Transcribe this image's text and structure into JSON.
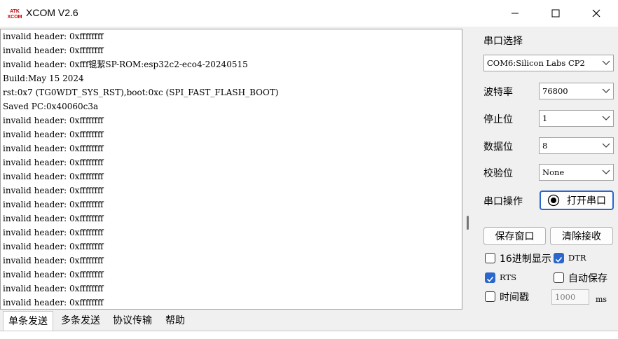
{
  "window": {
    "title": "XCOM V2.6"
  },
  "log_lines": [
    "invalid header: 0xffffffff",
    "invalid header: 0xffffffff",
    "invalid header: 0xfff锟絜SP-ROM:esp32c2-eco4-20240515",
    "Build:May 15 2024",
    "rst:0x7 (TG0WDT_SYS_RST),boot:0xc (SPI_FAST_FLASH_BOOT)",
    "Saved PC:0x40060c3a",
    "invalid header: 0xffffffff",
    "invalid header: 0xffffffff",
    "invalid header: 0xffffffff",
    "invalid header: 0xffffffff",
    "invalid header: 0xffffffff",
    "invalid header: 0xffffffff",
    "invalid header: 0xffffffff",
    "invalid header: 0xffffffff",
    "invalid header: 0xffffffff",
    "invalid header: 0xffffffff",
    "invalid header: 0xffffffff",
    "invalid header: 0xffffffff",
    "invalid header: 0xffffffff",
    "invalid header: 0xffffffff"
  ],
  "settings": {
    "port_select_label": "串口选择",
    "port_value": "COM6:Silicon Labs CP2",
    "baud_label": "波特率",
    "baud_value": "76800",
    "stopbits_label": "停止位",
    "stopbits_value": "1",
    "databits_label": "数据位",
    "databits_value": "8",
    "parity_label": "校验位",
    "parity_value": "None",
    "port_op_label": "串口操作",
    "open_port_label": "打开串口",
    "save_window_label": "保存窗口",
    "clear_recv_label": "清除接收",
    "hex_display_label": "16进制显示",
    "dtr_label": "DTR",
    "rts_label": "RTS",
    "auto_save_label": "自动保存",
    "timestamp_label": "时间戳",
    "timestamp_value": "1000",
    "timestamp_unit": "ms"
  },
  "tabs": [
    "单条发送",
    "多条发送",
    "协议传输",
    "帮助"
  ],
  "colors": {
    "accent": "#2a66cc",
    "background": "#f0f0f0"
  }
}
